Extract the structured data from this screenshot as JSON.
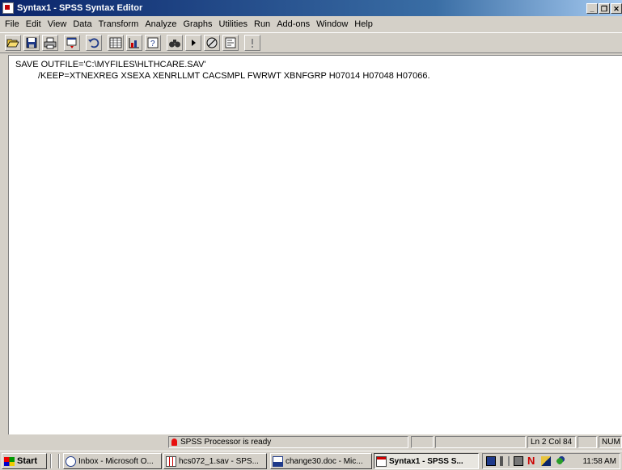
{
  "window": {
    "title": "Syntax1 - SPSS Syntax Editor"
  },
  "menu": [
    "File",
    "Edit",
    "View",
    "Data",
    "Transform",
    "Analyze",
    "Graphs",
    "Utilities",
    "Run",
    "Add-ons",
    "Window",
    "Help"
  ],
  "toolbar": {
    "icons": [
      "open-icon",
      "save-icon",
      "print-icon",
      "dialog-recall-icon",
      "undo-icon",
      "goto-data-icon",
      "goto-chart-icon",
      "variables-icon",
      "find-icon",
      "run-icon",
      "stop-icon",
      "syntax-help-icon",
      "designate-window-icon"
    ]
  },
  "editor": {
    "lines": [
      "SAVE OUTFILE='C:\\MYFILES\\HLTHCARE.SAV'",
      "/KEEP=XTNEXREG XSEXA XENRLLMT CACSMPL FWRWT XBNFGRP H07014 H07048 H07066."
    ]
  },
  "status": {
    "processor": "SPSS Processor  is ready",
    "position": "Ln 2 Col 84",
    "num": "NUM"
  },
  "taskbar": {
    "start": "Start",
    "tasks": [
      {
        "label": "Inbox - Microsoft O...",
        "icon": "outlook-icon"
      },
      {
        "label": "hcs072_1.sav - SPS...",
        "icon": "spss-data-icon"
      },
      {
        "label": "change30.doc - Mic...",
        "icon": "word-icon"
      },
      {
        "label": "Syntax1 - SPSS S...",
        "icon": "spss-syntax-icon",
        "active": true
      }
    ],
    "clock": "11:58 AM"
  },
  "colors": {
    "titlebar_start": "#0a246a",
    "titlebar_end": "#a6caf0",
    "chrome": "#d4d0c8"
  }
}
